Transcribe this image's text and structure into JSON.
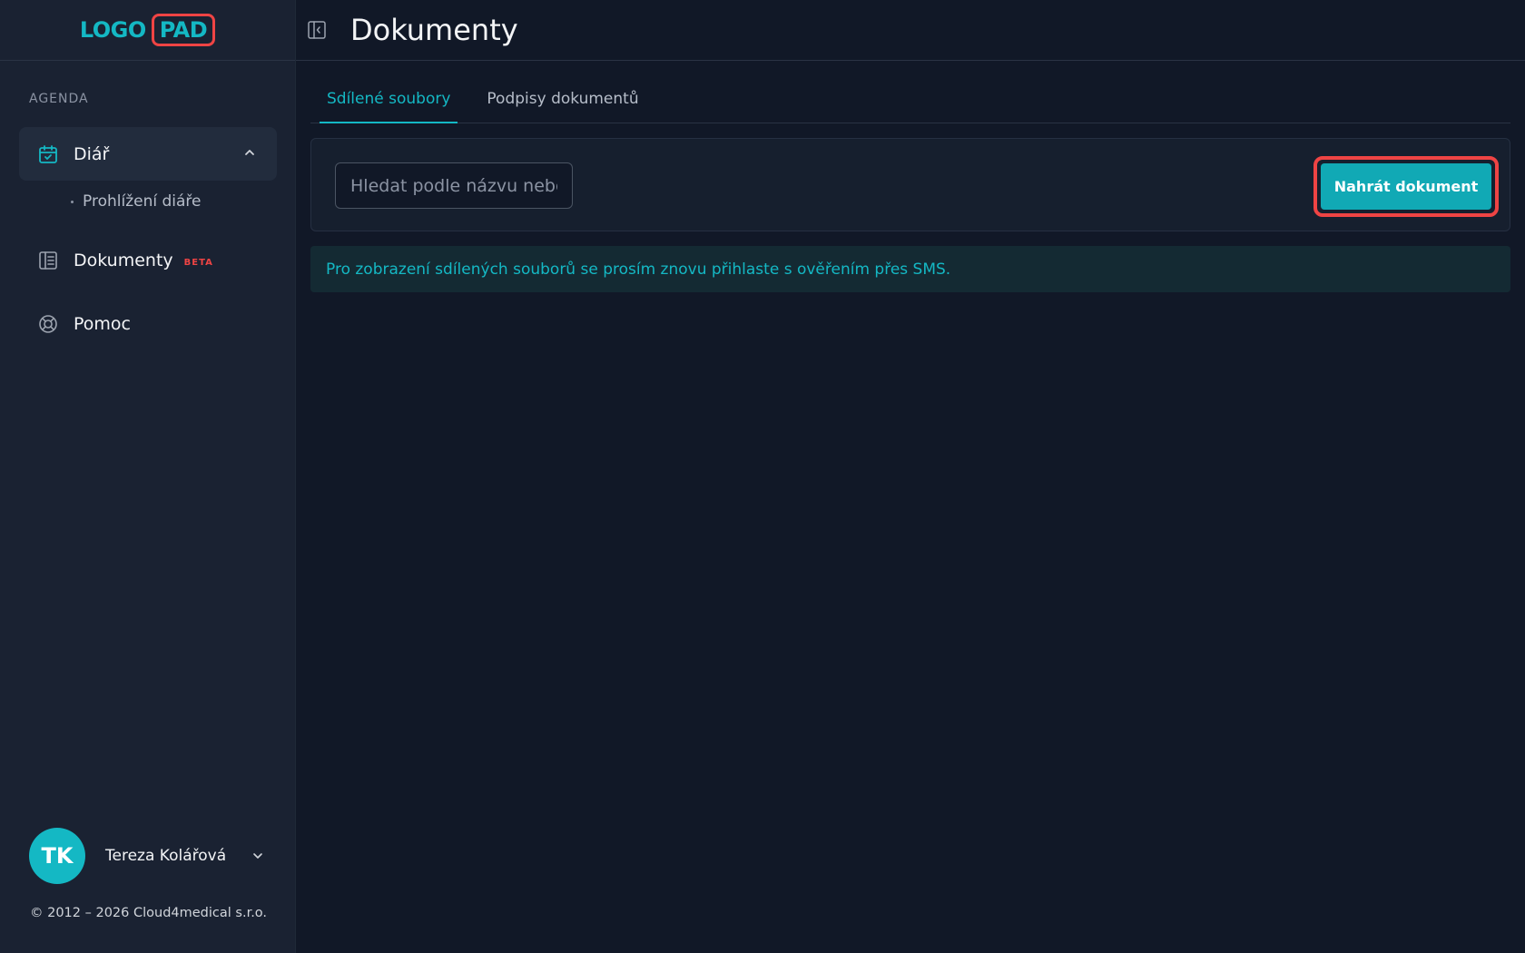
{
  "brand": {
    "logo_left": "LOGO",
    "logo_right": "PAD",
    "accent": "#14b8c4",
    "highlight": "#ef4444"
  },
  "sidebar": {
    "section_label": "AGENDA",
    "items": [
      {
        "label": "Diář",
        "icon": "calendar-check-icon",
        "expanded": true,
        "children": [
          {
            "label": "Prohlížení diáře"
          }
        ]
      },
      {
        "label": "Dokumenty",
        "icon": "document-icon",
        "badge": "BETA"
      },
      {
        "label": "Pomoc",
        "icon": "lifebuoy-icon"
      }
    ],
    "user": {
      "initials": "TK",
      "name": "Tereza Kolářová"
    },
    "copyright": "© 2012 – 2026 Cloud4medical s.r.o."
  },
  "header": {
    "title": "Dokumenty",
    "collapse_icon": "sidebar-collapse-icon"
  },
  "tabs": [
    {
      "label": "Sdílené soubory",
      "active": true
    },
    {
      "label": "Podpisy dokumentů",
      "active": false
    }
  ],
  "toolbar": {
    "search_placeholder": "Hledat podle názvu nebo",
    "upload_label": "Nahrát dokument"
  },
  "banner": {
    "text": "Pro zobrazení sdílených souborů se prosím znovu přihlaste s ověřením přes SMS."
  }
}
